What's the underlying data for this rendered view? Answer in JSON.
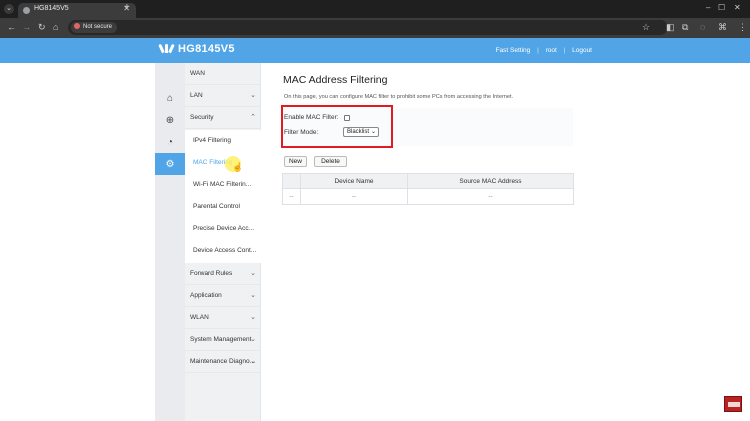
{
  "browser": {
    "tab_title": "HG8145V5",
    "tab_close": "✕",
    "new_tab": "+",
    "security_chip": "Not secure"
  },
  "router": {
    "brand": "HG8145V5",
    "header_links": [
      "Fast Setting",
      "|",
      "root",
      "|",
      "Logout"
    ]
  },
  "nav_menu": {
    "items": [
      {
        "label": "WAN",
        "chevron": ""
      },
      {
        "label": "LAN",
        "chevron": "⌄"
      },
      {
        "label": "Security",
        "chevron": "⌃"
      }
    ],
    "security_subitems": [
      "IPv4 Filtering",
      "MAC Filtering",
      "Wi-Fi MAC Filterin...",
      "Parental Control",
      "Precise Device Acc...",
      "Device Access Cont..."
    ],
    "lower_items": [
      {
        "label": "Forward Rules",
        "chevron": "⌄"
      },
      {
        "label": "Application",
        "chevron": "⌄"
      },
      {
        "label": "WLAN",
        "chevron": "⌄"
      },
      {
        "label": "System Management",
        "chevron": "⌄"
      },
      {
        "label": "Maintenance Diagno...",
        "chevron": "⌄"
      }
    ]
  },
  "main": {
    "title": "MAC Address Filtering",
    "description": "On this page, you can configure MAC filter to prohibit some PCs from accessing the Internet.",
    "enable_label": "Enable MAC Filter:",
    "filter_mode_label": "Filter Mode:",
    "filter_mode_value": "Blacklist",
    "new_button": "New",
    "delete_button": "Delete",
    "table": {
      "columns": [
        "",
        "Device Name",
        "Source MAC Address"
      ],
      "rows": [
        [
          "--",
          "--",
          "--"
        ]
      ]
    }
  },
  "colors": {
    "header_blue": "#51a5e6",
    "highlight_red": "#e01b24"
  }
}
